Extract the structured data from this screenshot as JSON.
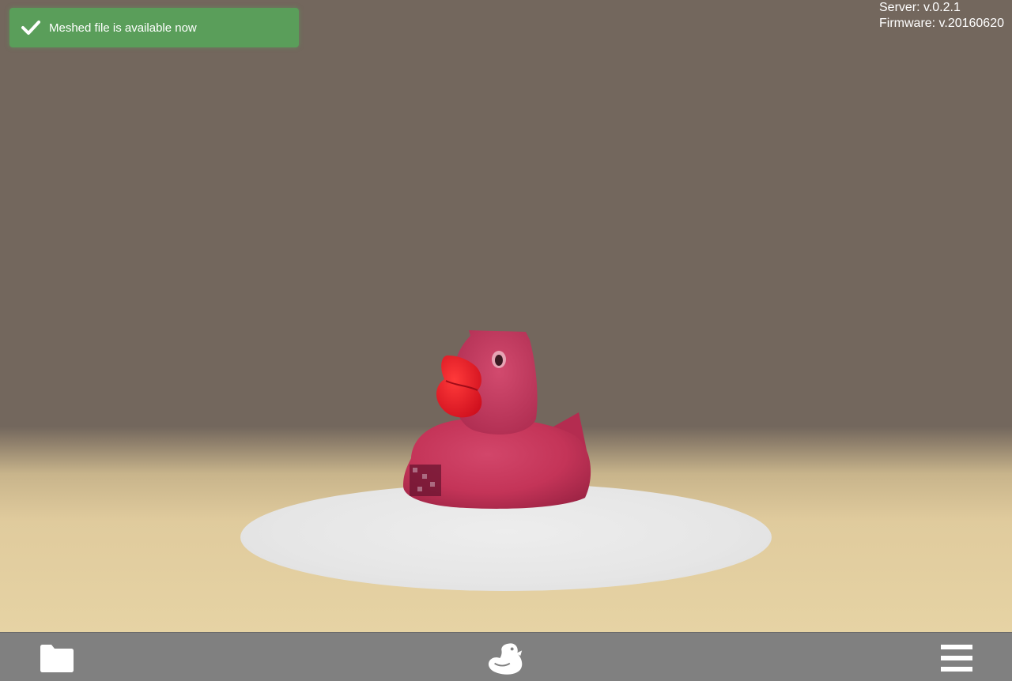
{
  "toast": {
    "message": "Meshed file is available now",
    "icon": "check-icon",
    "color": "#5a9e5a"
  },
  "version_info": {
    "server": "Server: v.0.2.1",
    "firmware": "Firmware: v.20160620"
  },
  "bottom_bar": {
    "left_icon": "folder-icon",
    "center_icon": "duck-logo-icon",
    "right_icon": "hamburger-menu-icon",
    "color": "#808080"
  },
  "scene": {
    "model_color": "#c8375a",
    "beak_color": "#e8182a",
    "platform_color": "#e8e8e8"
  }
}
